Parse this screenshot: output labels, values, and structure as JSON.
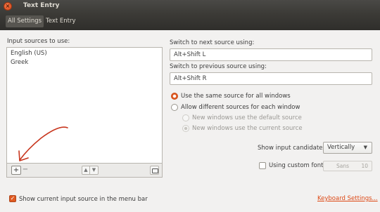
{
  "window": {
    "title": "Text Entry"
  },
  "toolbar": {
    "all_settings": "All Settings",
    "current": "Text Entry"
  },
  "sources": {
    "header": "Input sources to use:",
    "items": [
      "English (US)",
      "Greek"
    ],
    "add_label": "+",
    "remove_label": "−",
    "up_label": "▲",
    "down_label": "▼"
  },
  "shortcuts": {
    "next_label": "Switch to next source using:",
    "next_value": "Alt+Shift L",
    "prev_label": "Switch to previous source using:",
    "prev_value": "Alt+Shift R"
  },
  "window_mode": {
    "same": "Use the same source for all windows",
    "different": "Allow different sources for each window",
    "default": "New windows use the default source",
    "current": "New windows use the current source",
    "selected": "same"
  },
  "candidates": {
    "label": "Show input candidates:",
    "value": "Vertically"
  },
  "custom_font": {
    "label": "Using custom font:",
    "font": "Sans",
    "size": "10",
    "checked": false
  },
  "menu_bar": {
    "label": "Show current input source in the menu bar",
    "checked": true
  },
  "footer": {
    "keyboard_settings": "Keyboard Settings..."
  },
  "colors": {
    "accent": "#dd4814",
    "annotation": "#c8361e",
    "titlebar": "#3c3b37"
  }
}
